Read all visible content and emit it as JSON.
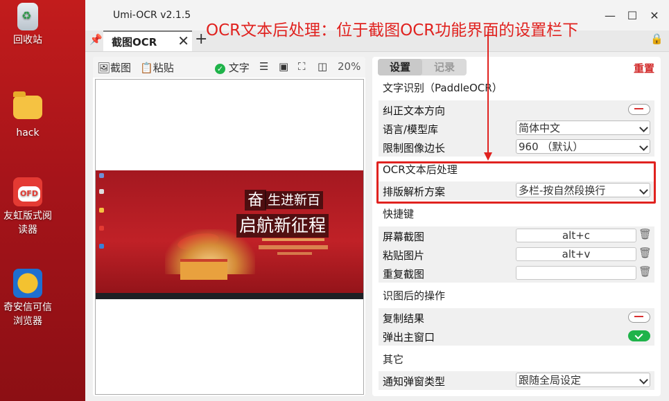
{
  "desktop": {
    "icons": [
      {
        "label": "回收站",
        "icon": "recycle-bin-icon"
      },
      {
        "label": "hack",
        "icon": "folder-icon"
      },
      {
        "label": "友虹版式阅读器",
        "icon": "ofd-reader-icon"
      },
      {
        "label": "奇安信可信浏览器",
        "icon": "qianxin-browser-icon"
      }
    ]
  },
  "window": {
    "title": "Umi-OCR v2.1.5",
    "controls": {
      "minimize": "—",
      "maximize": "☐",
      "close": "✕"
    }
  },
  "tabs": {
    "pin": "📌",
    "active_tab": "截图OCR",
    "close": "✕",
    "add": "+",
    "lock": "🔒"
  },
  "left_toolbar": {
    "screenshot": "截图",
    "paste": "粘贴",
    "text_toggle": "文字",
    "zoom": "20%"
  },
  "preview": {
    "ocr_text_1": "奋",
    "ocr_text_2": "生进新百",
    "ocr_text_3": "启航新征程"
  },
  "settings": {
    "tab_settings": "设置",
    "tab_records": "记录",
    "reset": "重置",
    "section_ocr": "文字识别（PaddleOCR）",
    "fix_direction": "纠正文本方向",
    "language": "语言/模型库",
    "language_value": "简体中文",
    "limit_side": "限制图像边长",
    "limit_side_value": "960 （默认）",
    "section_post": "OCR文本后处理",
    "layout_scheme": "排版解析方案",
    "layout_scheme_value": "多栏-按自然段换行",
    "section_hotkeys": "快捷键",
    "hk_screenshot": "屏幕截图",
    "hk_screenshot_value": "alt+c",
    "hk_paste": "粘贴图片",
    "hk_paste_value": "alt+v",
    "hk_repeat": "重复截图",
    "hk_repeat_value": "",
    "section_after": "识图后的操作",
    "copy_result": "复制结果",
    "popup_main": "弹出主窗口",
    "section_other": "其它",
    "notify_type": "通知弹窗类型",
    "notify_type_value": "跟随全局设定"
  },
  "toggles": {
    "fix_direction": false,
    "copy_result": false,
    "popup_main": true
  },
  "annotation": {
    "text": "OCR文本后处理：位于截图OCR功能界面的设置栏下",
    "color": "#e0221f"
  }
}
